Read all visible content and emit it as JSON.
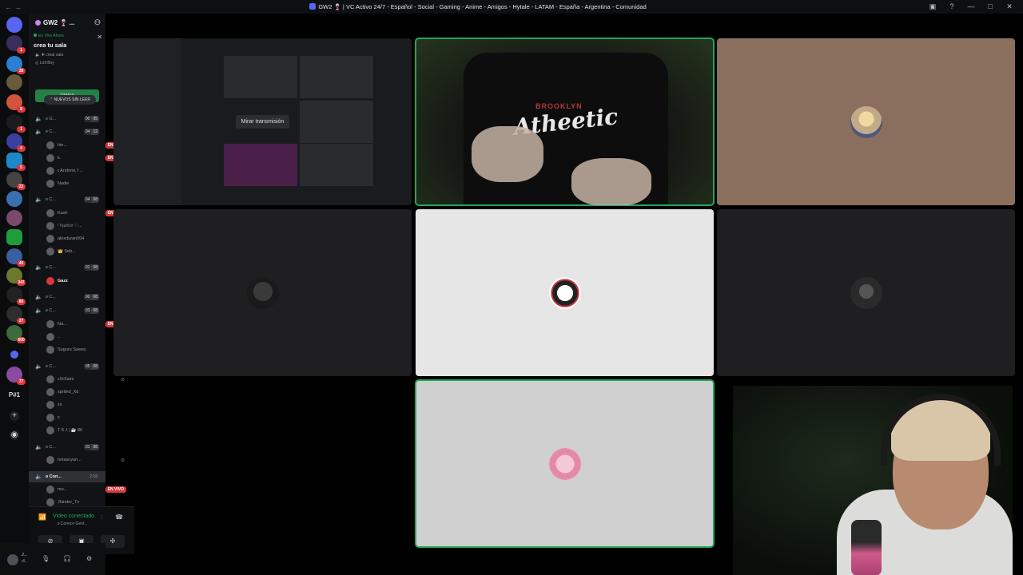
{
  "window": {
    "title": "GW2 🍷 | VC Activo 24/7 - Español - Social - Gaming - Anime - Amigos - Hytale - LATAM - España - Argentina - Comunidad"
  },
  "rail": {
    "badges": [
      "1",
      "28",
      "8",
      "1",
      "4",
      "5",
      "22",
      "40",
      "347",
      "80",
      "27",
      "600",
      "77"
    ],
    "label_p1": "P#1"
  },
  "server": {
    "name": "GW2 🍷 ...",
    "live_invite": {
      "label": "En Vivo Ahora",
      "room": "crea tu sala",
      "create": "crear sala",
      "user": "Lofi Boy",
      "join_button": "Unirse"
    },
    "new_unread": "NUEVOS SIN LEER"
  },
  "channels": [
    {
      "name": "ʚ G...",
      "count_a": "00",
      "count_b": "05"
    },
    {
      "name": "ʚ C...",
      "count_a": "04",
      "count_b": "12"
    },
    {
      "name": "ʚ C...",
      "count_a": "04",
      "count_b": "08"
    },
    {
      "name": "ʚ C...",
      "count_a": "01",
      "count_b": "08"
    },
    {
      "name": "ʚ C...",
      "count_a": "00",
      "count_b": "08"
    },
    {
      "name": "ʚ C...",
      "count_a": "03",
      "count_b": "08"
    },
    {
      "name": "ʚ C...",
      "count_a": "05",
      "count_b": "08"
    },
    {
      "name": "ʚ C...",
      "count_a": "01",
      "count_b": "08"
    },
    {
      "name": "ʚ Con...",
      "time": "2:18"
    }
  ],
  "users": [
    {
      "name": "hie...",
      "live": "EN VIVO"
    },
    {
      "name": "k.",
      "live": "EN VIVO"
    },
    {
      "name": "ɪ Andrew, f ..."
    },
    {
      "name": "Nadie"
    },
    {
      "name": "Kash",
      "live": "EN VIVO"
    },
    {
      "name": "ᶠ ℕ𝕒𝕙𝕚𝕣 ♡..."
    },
    {
      "name": "alexduran004"
    },
    {
      "name": "👑 Seb..."
    },
    {
      "name": "Gazz"
    },
    {
      "name": "Na...",
      "live": "EN VIVO"
    },
    {
      "name": ".."
    },
    {
      "name": "Suguru Sawey"
    },
    {
      "name": "c0c0aini"
    },
    {
      "name": "sprited_Xd"
    },
    {
      "name": "xx"
    },
    {
      "name": "x"
    },
    {
      "name": "T 8 J | ☕ 86"
    },
    {
      "name": "holasoyun..."
    },
    {
      "name": "mo...",
      "live": "EN VIVO"
    },
    {
      "name": "Jhinder_Tv"
    }
  ],
  "voice": {
    "status": "Video conectado",
    "channel": "ʚ Conoce Gent..."
  },
  "user_panel": {
    "name": "J...",
    "status": "dl.."
  },
  "video": {
    "watch_stream": "Mirar transmisión",
    "shirt_text": "Atheetic",
    "shirt_sub": "BROOKLYN"
  }
}
